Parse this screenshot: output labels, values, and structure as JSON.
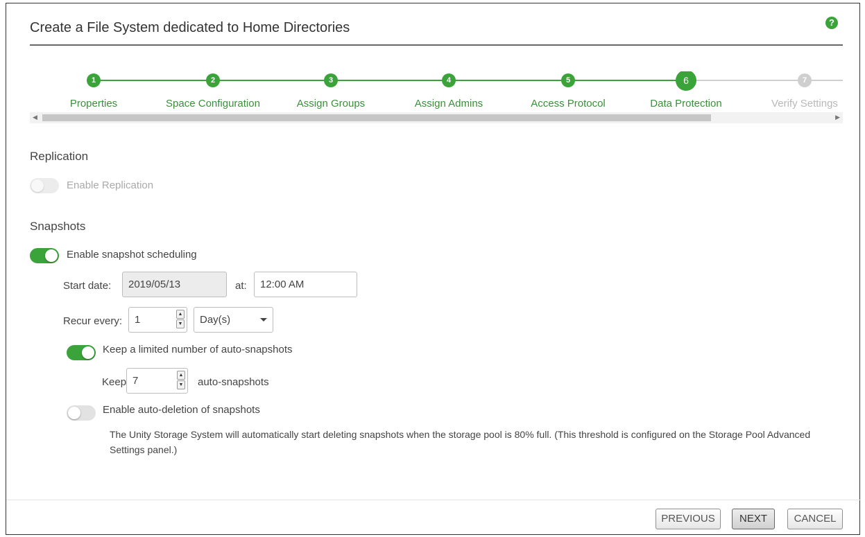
{
  "dialog": {
    "title": "Create a File System dedicated to Home Directories",
    "help_icon": "?"
  },
  "steps": [
    {
      "num": "1",
      "label": "Properties",
      "state": "done"
    },
    {
      "num": "2",
      "label": "Space Configuration",
      "state": "done"
    },
    {
      "num": "3",
      "label": "Assign Groups",
      "state": "done"
    },
    {
      "num": "4",
      "label": "Assign Admins",
      "state": "done"
    },
    {
      "num": "5",
      "label": "Access Protocol",
      "state": "done"
    },
    {
      "num": "6",
      "label": "Data Protection",
      "state": "current"
    },
    {
      "num": "7",
      "label": "Verify Settings",
      "state": "future"
    }
  ],
  "replication": {
    "section_title": "Replication",
    "toggle_label": "Enable Replication"
  },
  "snapshots": {
    "section_title": "Snapshots",
    "enable_label": "Enable snapshot scheduling",
    "start_date_label": "Start date:",
    "start_date_value": "2019/05/13",
    "at_label": "at:",
    "time_value": "12:00 AM",
    "recur_label": "Recur every:",
    "recur_value": "1",
    "recur_unit": "Day(s)",
    "keep_limited_label": "Keep a limited number of auto-snapshots",
    "keep_label": "Keep",
    "keep_value": "7",
    "keep_suffix": "auto-snapshots",
    "auto_delete_label": "Enable auto-deletion of snapshots",
    "auto_delete_note": "The Unity Storage System will automatically start deleting snapshots when the storage pool is 80% full. (This threshold is configured on the Storage Pool Advanced Settings panel.)"
  },
  "footer": {
    "previous": "PREVIOUS",
    "next": "NEXT",
    "cancel": "CANCEL"
  },
  "colors": {
    "accent": "#3aa33a",
    "inactive": "#cfcfcf"
  }
}
